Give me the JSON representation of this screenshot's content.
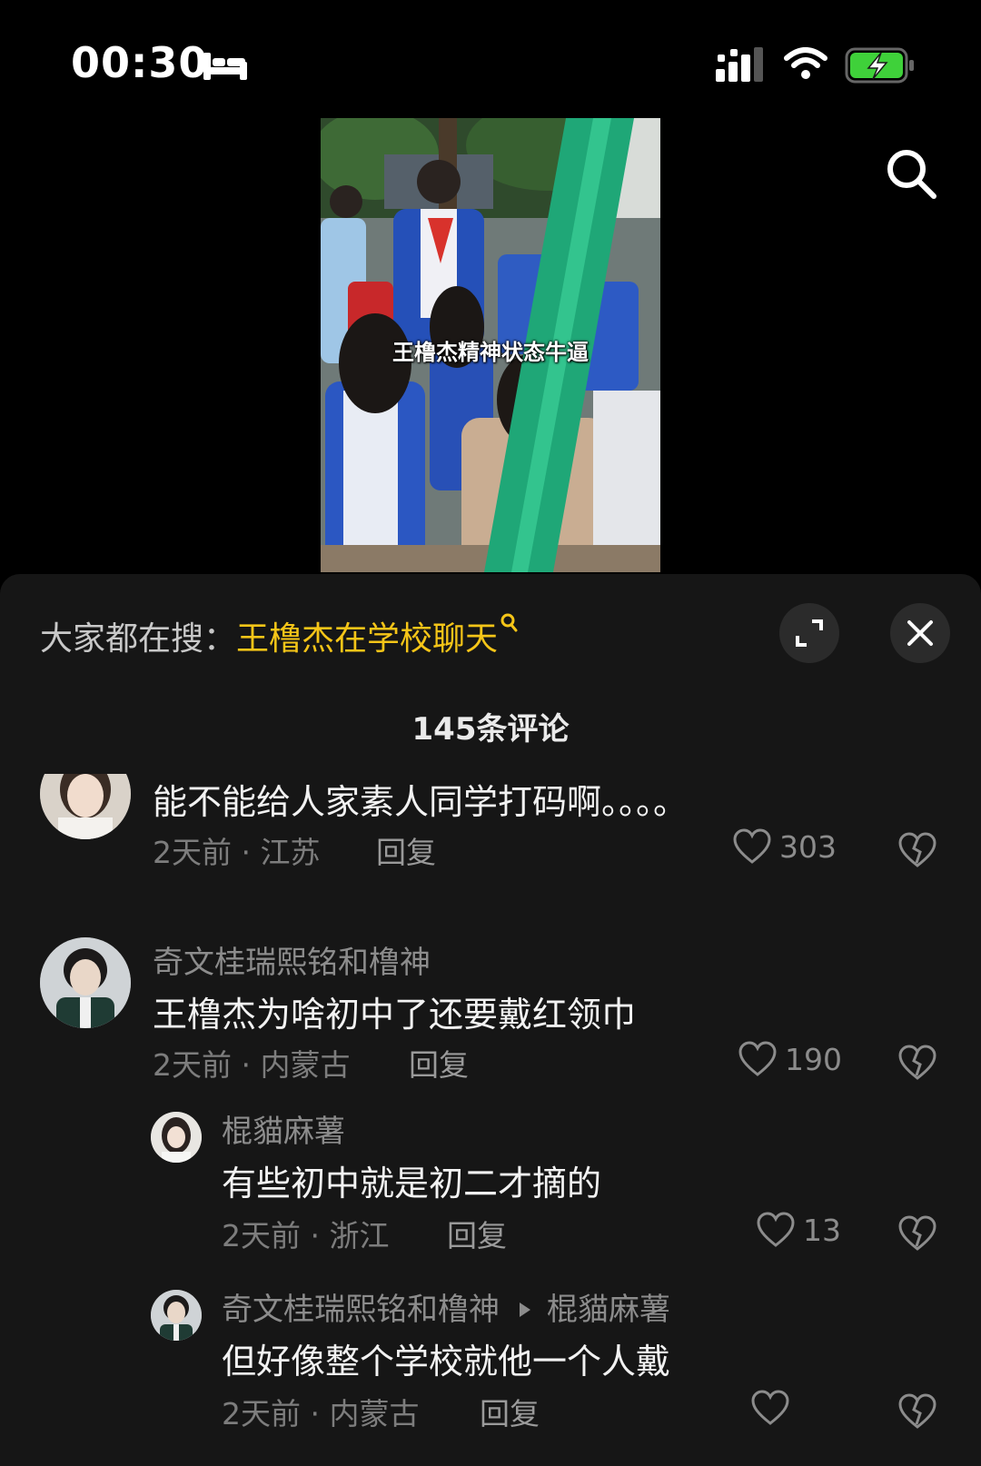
{
  "status_bar": {
    "time": "00:30"
  },
  "video": {
    "caption": "王橹杰精神状态牛逼"
  },
  "panel": {
    "trending_prefix": "大家都在搜：",
    "trending_term": "王橹杰在学校聊天",
    "comment_count_label": "145条评论"
  },
  "comments": [
    {
      "author": "",
      "text": "能不能给人家素人同学打码啊。。。。",
      "time": "2天前",
      "location": "江苏",
      "reply_label": "回复",
      "likes": "303"
    },
    {
      "author": "奇文桂瑞熙铭和橹神",
      "text": "王橹杰为啥初中了还要戴红领巾",
      "time": "2天前",
      "location": "内蒙古",
      "reply_label": "回复",
      "likes": "190"
    },
    {
      "author": "棍貓麻薯",
      "text": "有些初中就是初二才摘的",
      "time": "2天前",
      "location": "浙江",
      "reply_label": "回复",
      "likes": "13"
    },
    {
      "author": "奇文桂瑞熙铭和橹神",
      "reply_to": "棍貓麻薯",
      "text": "但好像整个学校就他一个人戴",
      "time": "2天前",
      "location": "内蒙古",
      "reply_label": "回复",
      "likes": ""
    }
  ]
}
